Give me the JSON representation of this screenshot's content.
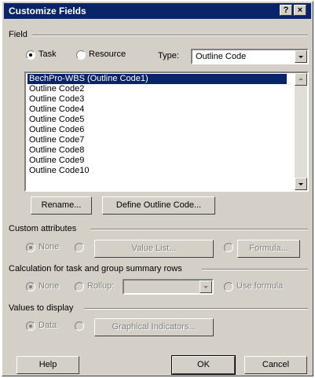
{
  "title": "Customize Fields",
  "titlebar_buttons": {
    "help": "?",
    "close": "×"
  },
  "field": {
    "legend": "Field",
    "task_label": "Task",
    "resource_label": "Resource",
    "type_label": "Type:",
    "type_value": "Outline Code",
    "items": [
      "BechPro-WBS (Outline Code1)",
      "Outline Code2",
      "Outline Code3",
      "Outline Code4",
      "Outline Code5",
      "Outline Code6",
      "Outline Code7",
      "Outline Code8",
      "Outline Code9",
      "Outline Code10"
    ],
    "rename_label": "Rename...",
    "define_label": "Define Outline Code..."
  },
  "custom_attributes": {
    "legend": "Custom attributes",
    "none_label": "None",
    "value_list_label": "Value List...",
    "formula_label": "Formula..."
  },
  "calculation": {
    "legend": "Calculation for task and group summary rows",
    "none_label": "None",
    "rollup_label": "Rollup:",
    "use_formula_label": "Use formula"
  },
  "values_display": {
    "legend": "Values to display",
    "data_label": "Data",
    "graphical_label": "Graphical Indicators..."
  },
  "footer": {
    "help_label": "Help",
    "ok_label": "OK",
    "cancel_label": "Cancel"
  }
}
